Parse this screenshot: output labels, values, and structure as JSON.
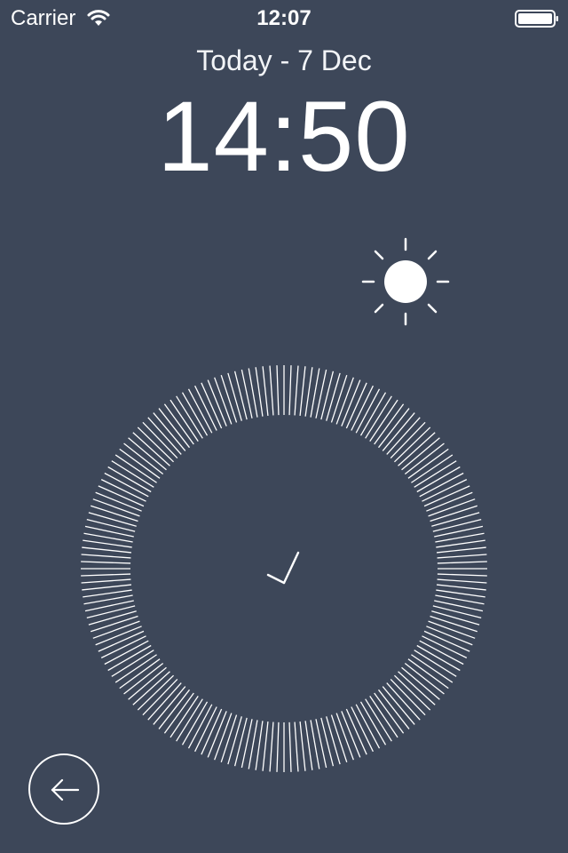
{
  "status_bar": {
    "carrier": "Carrier",
    "time": "12:07",
    "wifi_icon": "wifi-icon",
    "battery_icon": "battery-icon"
  },
  "header": {
    "date": "Today - 7 Dec",
    "time": "14:50"
  },
  "weather": {
    "icon": "sun-icon"
  },
  "dial": {
    "tick_count": 180,
    "hand_icon": "clock-hands-icon"
  },
  "footer": {
    "back_icon": "arrow-left-icon"
  },
  "colors": {
    "background": "#3d4759",
    "foreground": "#ffffff"
  }
}
